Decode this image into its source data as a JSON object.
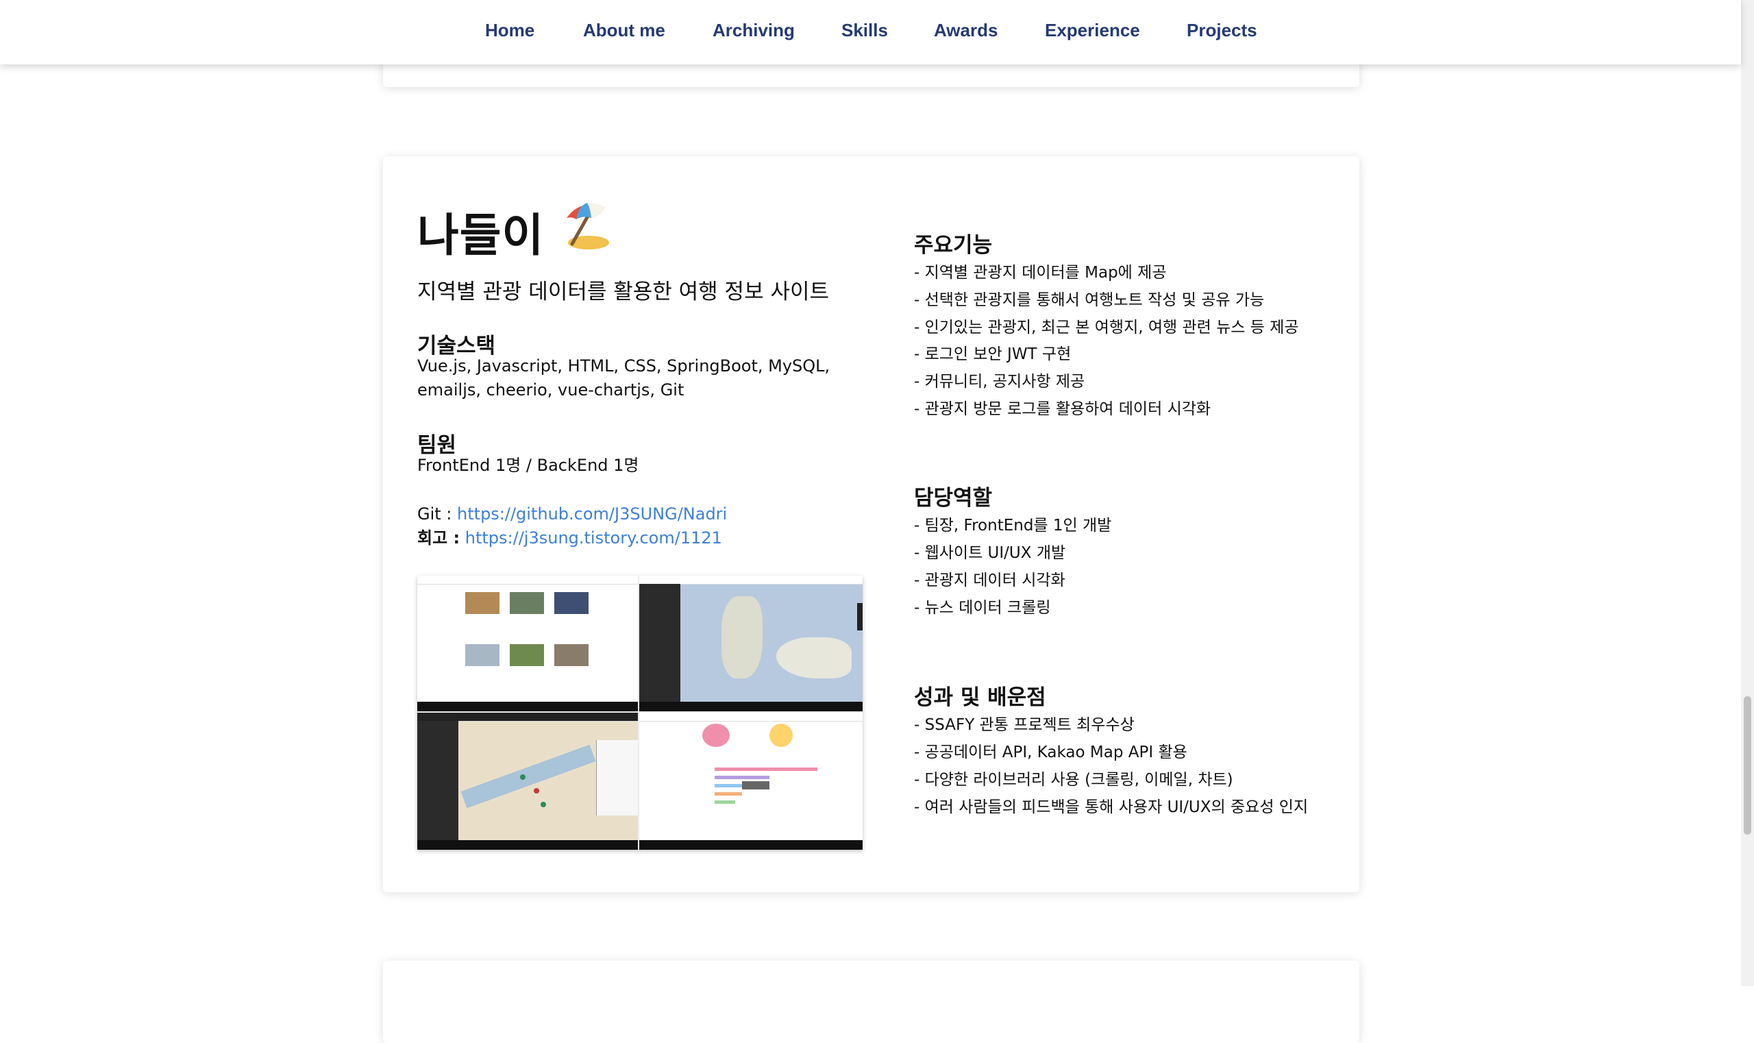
{
  "nav": {
    "items": [
      {
        "label": "Home"
      },
      {
        "label": "About me"
      },
      {
        "label": "Archiving"
      },
      {
        "label": "Skills"
      },
      {
        "label": "Awards"
      },
      {
        "label": "Experience"
      },
      {
        "label": "Projects"
      }
    ],
    "color": "#253a73"
  },
  "project": {
    "title": "나들이",
    "icon": "beach-umbrella-icon",
    "subtitle": "지역별 관광 데이터를 활용한 여행 정보 사이트",
    "stack": {
      "heading": "기술스택",
      "line1": "Vue.js, Javascript, HTML, CSS, SpringBoot, MySQL,",
      "line2": "emailjs, cheerio, vue-chartjs, Git"
    },
    "team": {
      "heading": "팀원",
      "value": "FrontEnd 1명 / BackEnd 1명"
    },
    "git": {
      "label": "Git :",
      "url": "https://github.com/J3SUNG/Nadri"
    },
    "retro": {
      "label": "회고 :",
      "url": "https://j3sung.tistory.com/1121"
    },
    "features": {
      "heading": "주요기능",
      "items": [
        "- 지역별 관광지 데이터를 Map에 제공",
        "- 선택한 관광지를 통해서 여행노트 작성 및 공유 가능",
        "- 인기있는 관광지, 최근 본 여행지, 여행 관련 뉴스 등 제공",
        "- 로그인 보안 JWT 구현",
        "- 커뮤니티, 공지사항 제공",
        "- 관광지 방문 로그를 활용하여 데이터 시각화"
      ]
    },
    "role": {
      "heading": "담당역할",
      "items": [
        "- 팀장, FrontEnd를 1인 개발",
        "- 웹사이트 UI/UX 개발",
        "- 관광지 데이터 시각화",
        "- 뉴스 데이터 크롤링"
      ]
    },
    "results": {
      "heading": "성과 및 배운점",
      "items": [
        "- SSAFY 관통 프로젝트 최우수상",
        "- 공공데이터 API, Kakao Map API 활용",
        "- 다양한 라이브러리 사용 (크롤링, 이메일, 차트)",
        "- 여러 사람들의 피드백을 통해 사용자 UI/UX의 중요성 인지"
      ]
    }
  },
  "colors": {
    "link": "#3d7fd8",
    "text": "#111111",
    "card_bg": "#ffffff"
  }
}
